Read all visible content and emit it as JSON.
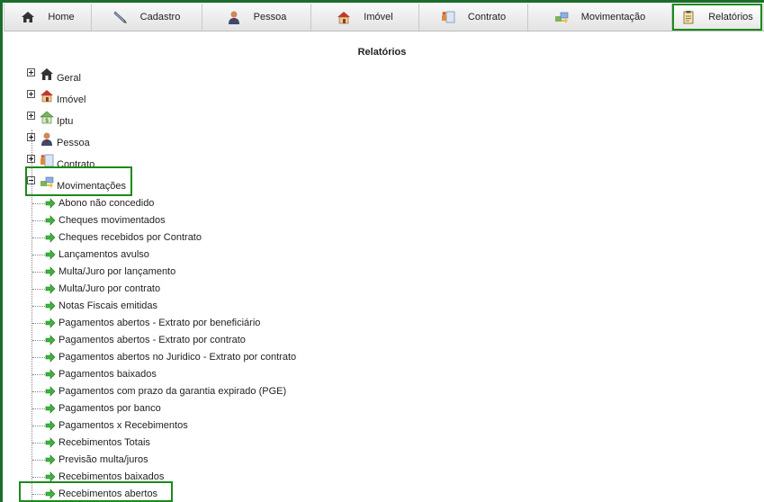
{
  "menu": [
    {
      "label": "Home",
      "icon": "home-icon"
    },
    {
      "label": "Cadastro",
      "icon": "pen-icon"
    },
    {
      "label": "Pessoa",
      "icon": "person-icon"
    },
    {
      "label": "Imóvel",
      "icon": "house-icon"
    },
    {
      "label": "Contrato",
      "icon": "contract-icon"
    },
    {
      "label": "Movimentação",
      "icon": "movement-icon"
    },
    {
      "label": "Relatórios",
      "icon": "report-icon",
      "active": true
    }
  ],
  "page_title": "Relatórios",
  "tree": {
    "groups": [
      {
        "label": "Geral",
        "icon": "home-icon",
        "expanded": false
      },
      {
        "label": "Imóvel",
        "icon": "house-icon",
        "expanded": false
      },
      {
        "label": "Iptu",
        "icon": "iptu-icon",
        "expanded": false
      },
      {
        "label": "Pessoa",
        "icon": "person-icon",
        "expanded": false
      },
      {
        "label": "Contrato",
        "icon": "contract-icon",
        "expanded": false
      },
      {
        "label": "Movimentações",
        "icon": "movement-icon",
        "expanded": true
      }
    ],
    "movimentacoes_items": [
      "Abono não concedido",
      "Cheques movimentados",
      "Cheques recebidos por Contrato",
      "Lançamentos avulso",
      "Multa/Juro por lançamento",
      "Multa/Juro por contrato",
      "Notas Fiscais emitidas",
      "Pagamentos abertos - Extrato por beneficiário",
      "Pagamentos abertos - Extrato por contrato",
      "Pagamentos abertos no Juridico - Extrato por contrato",
      "Pagamentos baixados",
      "Pagamentos com prazo da garantia expirado (PGE)",
      "Pagamentos por banco",
      "Pagamentos x Recebimentos",
      "Recebimentos Totais",
      "Previsão multa/juros",
      "Recebimentos baixados",
      "Recebimentos abertos"
    ]
  },
  "colors": {
    "frame": "#1e6b2e",
    "highlight": "#1b8a1b",
    "arrow": "#3cb43c"
  }
}
